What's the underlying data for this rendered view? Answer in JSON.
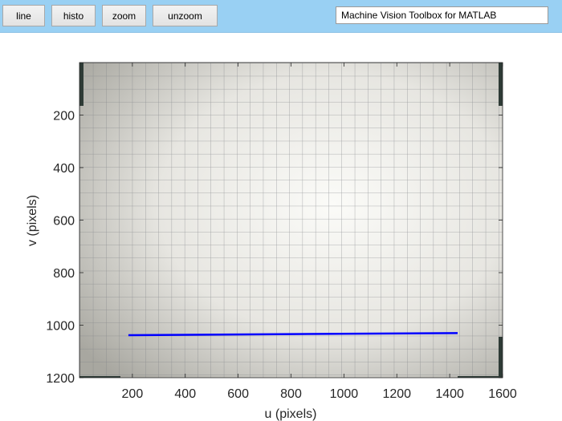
{
  "toolbar": {
    "buttons": [
      {
        "id": "line",
        "label": "line"
      },
      {
        "id": "histo",
        "label": "histo"
      },
      {
        "id": "zoom",
        "label": "zoom"
      },
      {
        "id": "unzoom",
        "label": "unzoom"
      }
    ],
    "title": "Machine Vision Toolbox for MATLAB"
  },
  "plot": {
    "xlabel": "u (pixels)",
    "ylabel": "v (pixels)",
    "xlim": [
      0,
      1600
    ],
    "ylim": [
      0,
      1200
    ],
    "xticks": [
      200,
      400,
      600,
      800,
      1000,
      1200,
      1400,
      1600
    ],
    "yticks": [
      200,
      400,
      600,
      800,
      1000,
      1200
    ],
    "y_reversed": true,
    "image": "grayscale photo of a grid sheet",
    "line_color": "#0000ff",
    "line_points": [
      [
        185,
        1038
      ],
      [
        1430,
        1030
      ]
    ]
  }
}
